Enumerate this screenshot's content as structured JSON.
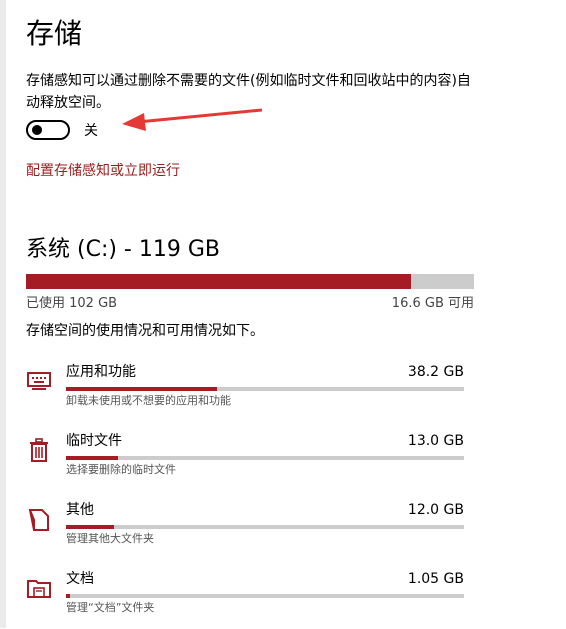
{
  "page": {
    "title": "存储",
    "description": "存储感知可以通过删除不需要的文件(例如临时文件和回收站中的内容)自动释放空间。",
    "toggle": {
      "state_label": "关",
      "on": false
    },
    "configure_link": "配置存储感知或立即运行"
  },
  "drive": {
    "title": "系统 (C:) - 119 GB",
    "used_label": "已使用 102 GB",
    "free_label": "16.6 GB 可用",
    "used_fraction": 0.86,
    "usage_description": "存储空间的使用情况和可用情况如下。"
  },
  "categories": [
    {
      "name": "应用和功能",
      "size": "38.2 GB",
      "sub": "卸载未使用或不想要的应用和功能",
      "fraction": 0.38,
      "icon": "monitor-icon"
    },
    {
      "name": "临时文件",
      "size": "13.0 GB",
      "sub": "选择要删除的临时文件",
      "fraction": 0.13,
      "icon": "trash-icon"
    },
    {
      "name": "其他",
      "size": "12.0 GB",
      "sub": "管理其他大文件夹",
      "fraction": 0.12,
      "icon": "file-icon"
    },
    {
      "name": "文档",
      "size": "1.05 GB",
      "sub": "管理“文档”文件夹",
      "fraction": 0.01,
      "icon": "folder-icon"
    }
  ],
  "colors": {
    "accent": "#a51c24",
    "link": "#9b1c1c",
    "bar_bg": "#cccccc",
    "arrow": "#e53935"
  }
}
